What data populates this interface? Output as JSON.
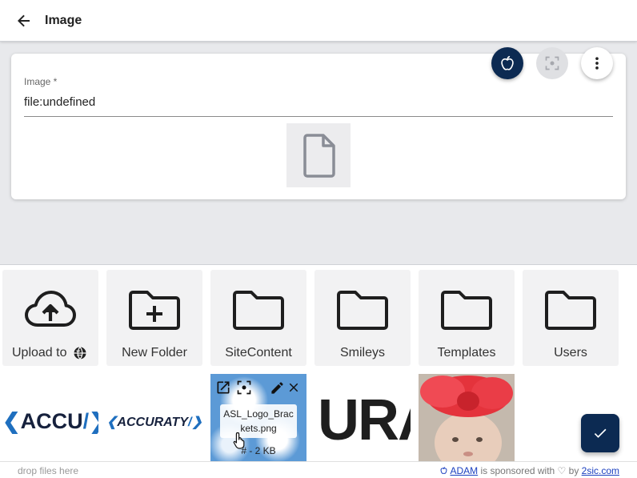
{
  "header": {
    "title": "Image"
  },
  "field": {
    "label": "Image *",
    "value": "file:undefined"
  },
  "toolbar": {
    "apple_icon": "apple-icon",
    "focus_icon": "focus-icon",
    "more_icon": "more-vert-icon"
  },
  "adam": {
    "tiles": [
      {
        "label": "Upload to",
        "icon": "cloud-upload-icon"
      },
      {
        "label": "New Folder",
        "icon": "folder-plus-icon"
      },
      {
        "label": "SiteContent",
        "icon": "folder-icon"
      },
      {
        "label": "Smileys",
        "icon": "folder-icon"
      },
      {
        "label": "Templates",
        "icon": "folder-icon"
      },
      {
        "label": "Users",
        "icon": "folder-icon"
      }
    ],
    "files": [
      {
        "logo_main": "ACCU",
        "logo_left": "❮",
        "logo_right": "/❯"
      },
      {
        "logo_main": "ACCURATY",
        "logo_left": "❮",
        "logo_right": "/❯"
      },
      {
        "name": "ASL_Logo_Brackets.png",
        "name_line1": "ASL_Logo_Brac",
        "name_line2": "kets.png",
        "size": "# - 2 KB"
      },
      {
        "logo_text": "URA"
      },
      {
        "name": ""
      }
    ]
  },
  "footer": {
    "drop": "drop files here",
    "sponsor_link": "ADAM",
    "sponsor_mid": " is sponsored with ♡ by ",
    "sponsor_company": "2sic.com"
  },
  "colors": {
    "primary": "#0c2a52",
    "accent_blue": "#1f6fbf"
  }
}
